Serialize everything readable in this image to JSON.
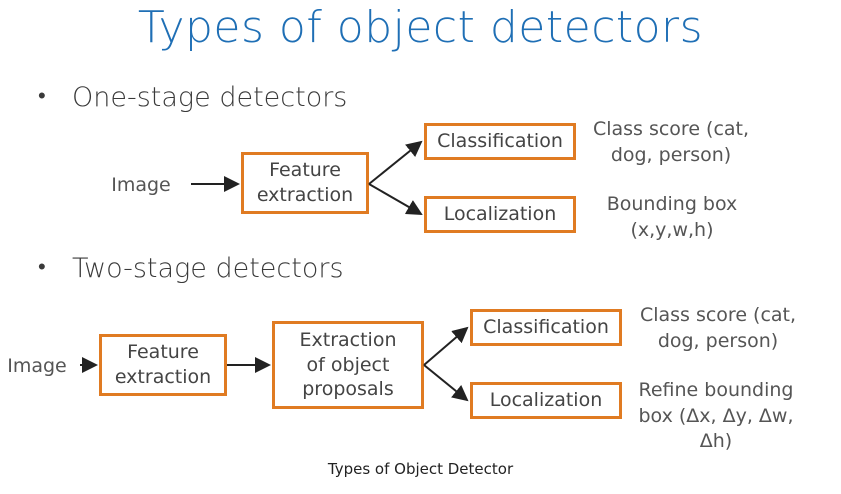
{
  "title": "Types of object detectors",
  "one_stage": {
    "heading": "One-stage detectors",
    "input": "Image",
    "feature": "Feature extraction",
    "classification": "Classification",
    "localization": "Localization",
    "class_output": "Class score (cat, dog, person)",
    "loc_output": "Bounding box (x,y,w,h)"
  },
  "two_stage": {
    "heading": "Two-stage detectors",
    "input": "Image",
    "feature": "Feature extraction",
    "proposals": "Extraction of object proposals",
    "classification": "Classification",
    "localization": "Localization",
    "class_output": "Class score (cat, dog, person)",
    "loc_output": "Refine bounding box (Δx, Δy, Δw, Δh)"
  },
  "caption": "Types of Object Detector",
  "colors": {
    "title": "#1f6fb5",
    "box_border": "#e07b22",
    "arrow": "#222222"
  }
}
